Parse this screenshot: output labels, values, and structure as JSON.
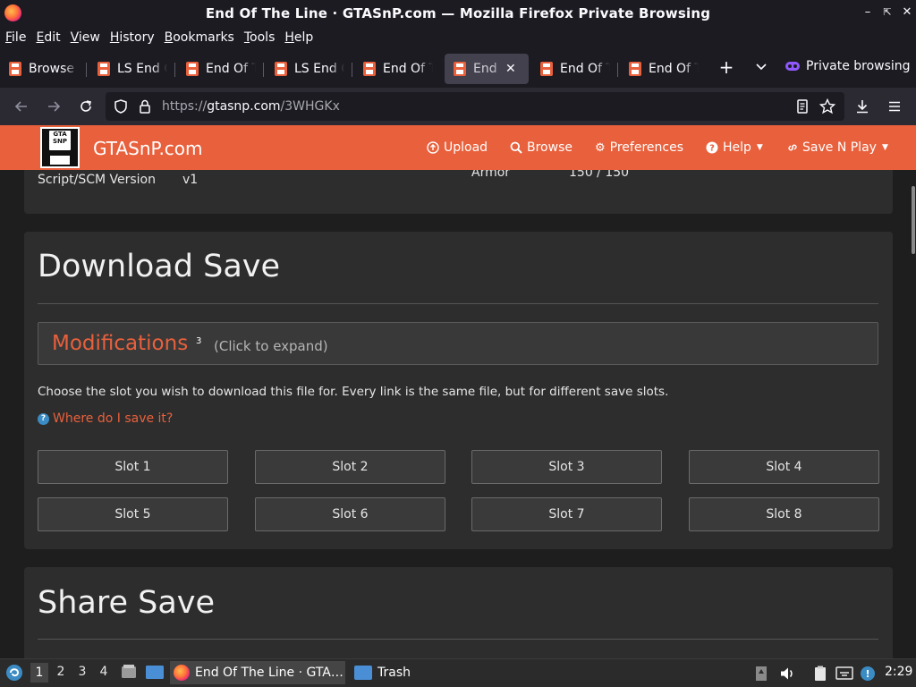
{
  "window": {
    "title": "End Of The Line · GTASnP.com — Mozilla Firefox Private Browsing"
  },
  "menubar": {
    "items": [
      {
        "label": "File",
        "key": "F"
      },
      {
        "label": "Edit",
        "key": "E"
      },
      {
        "label": "View",
        "key": "V"
      },
      {
        "label": "History",
        "key": "H"
      },
      {
        "label": "Bookmarks",
        "key": "B"
      },
      {
        "label": "Tools",
        "key": "T"
      },
      {
        "label": "Help",
        "key": "H"
      }
    ]
  },
  "tabs": [
    {
      "label": "Browse",
      "active": false
    },
    {
      "label": "LS End Of The Line",
      "active": false
    },
    {
      "label": "End Of The Line",
      "active": false
    },
    {
      "label": "LS End Of The Line",
      "active": false
    },
    {
      "label": "End Of The Line",
      "active": false
    },
    {
      "label": "End Of The Line",
      "active": true
    },
    {
      "label": "End Of The Line",
      "active": false
    },
    {
      "label": "End Of The Line",
      "active": false
    }
  ],
  "private_label": "Private browsing",
  "url": {
    "scheme": "https://",
    "host": "gtasnp.com",
    "path": "/3WHGKx"
  },
  "site": {
    "brand": "GTASnP.com",
    "logo_text": "GTA SNP",
    "nav": [
      {
        "label": "Upload",
        "icon": "upload-icon",
        "dropdown": false
      },
      {
        "label": "Browse",
        "icon": "search-icon",
        "dropdown": false
      },
      {
        "label": "Preferences",
        "icon": "gear-icon",
        "dropdown": false
      },
      {
        "label": "Help",
        "icon": "help-icon",
        "dropdown": true
      },
      {
        "label": "Save N Play",
        "icon": "link-icon",
        "dropdown": true
      }
    ]
  },
  "stats": {
    "script_label": "Script/SCM Version",
    "script_value": "v1",
    "armor_label": "Armor",
    "armor_value": "150 / 150"
  },
  "download": {
    "heading": "Download Save",
    "mods_title": "Modifications",
    "mods_count": "3",
    "mods_hint": "(Click to expand)",
    "description": "Choose the slot you wish to download this file for. Every link is the same file, but for different save slots.",
    "where_link": "Where do I save it?",
    "slots": [
      "Slot 1",
      "Slot 2",
      "Slot 3",
      "Slot 4",
      "Slot 5",
      "Slot 6",
      "Slot 7",
      "Slot 8"
    ]
  },
  "share": {
    "heading": "Share Save"
  },
  "taskbar": {
    "workspaces": [
      "1",
      "2",
      "3",
      "4"
    ],
    "active_workspace": "1",
    "items": [
      {
        "label": "End Of The Line · GTA…",
        "icon": "firefox-icon",
        "active": true
      },
      {
        "label": "Trash",
        "icon": "folder-icon",
        "active": false
      }
    ],
    "clock": "2:29"
  },
  "colors": {
    "accent": "#e8603c",
    "link_blue": "#3b8cc4",
    "private_purple": "#9059ff"
  }
}
